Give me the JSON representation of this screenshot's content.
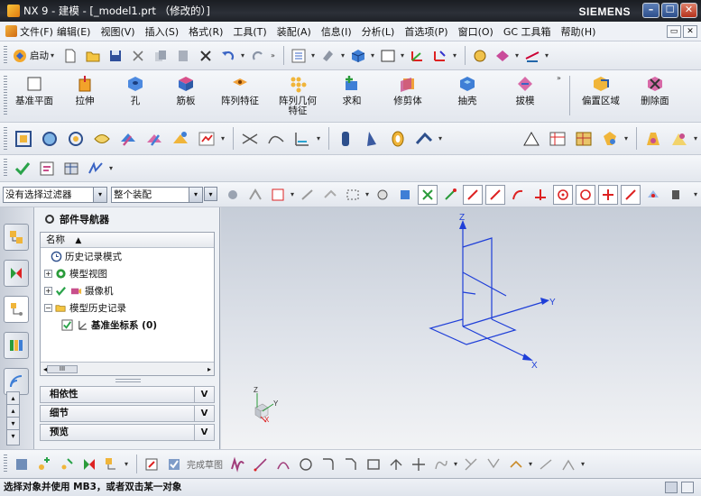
{
  "window": {
    "title": "NX 9 - 建模 - [_model1.prt （修改的）]",
    "brand": "SIEMENS",
    "min_label": "–",
    "max_label": "☐",
    "close_label": "✕"
  },
  "menu": {
    "items": [
      "文件(F)",
      "编辑(E)",
      "视图(V)",
      "插入(S)",
      "格式(R)",
      "工具(T)",
      "装配(A)",
      "信息(I)",
      "分析(L)",
      "首选项(P)",
      "窗口(O)",
      "GC 工具箱",
      "帮助(H)"
    ],
    "mdi_restore": "▭",
    "mdi_close": "✕"
  },
  "standard_toolbar": {
    "start_label": "启动",
    "overflow": "»"
  },
  "feature_toolbar": {
    "buttons": [
      "基准平面",
      "拉伸",
      "孔",
      "筋板",
      "阵列特征",
      "阵列几何\n特征",
      "求和",
      "修剪体",
      "抽壳",
      "拔模",
      "偏置区域",
      "删除面"
    ],
    "overflow": "»"
  },
  "filterbar": {
    "filter_value": "没有选择过滤器",
    "scope_value": "整个装配"
  },
  "navigator": {
    "title": "部件导航器",
    "column_name": "名称",
    "sort_indicator": "▲",
    "tree": [
      {
        "label": "历史记录模式",
        "expander": ""
      },
      {
        "label": "模型视图",
        "expander": "+"
      },
      {
        "label": "摄像机",
        "expander": "+"
      },
      {
        "label": "模型历史记录",
        "expander": "−"
      },
      {
        "label": "基准坐标系 (0)",
        "expander": ""
      }
    ],
    "scroll_left": "◂",
    "scroll_right": "▸",
    "scroll_thumb": "III",
    "sections": [
      {
        "label": "相依性",
        "chevron": "V"
      },
      {
        "label": "细节",
        "chevron": "V"
      },
      {
        "label": "预览",
        "chevron": "V"
      }
    ]
  },
  "graphics": {
    "axis_z": "Z",
    "axis_y": "Y",
    "axis_x": "X",
    "triad_z": "Z",
    "triad_y": "Y",
    "triad_x": "X"
  },
  "sketch_toolbar": {
    "finish_sketch_label": "完成草图"
  },
  "status": {
    "message": "选择对象并使用 MB3，或者双击某一对象"
  },
  "colors": {
    "axis_blue": "#1f3fd8",
    "viewport_top": "#c6cdd8",
    "viewport_bottom": "#f2f3f5"
  }
}
